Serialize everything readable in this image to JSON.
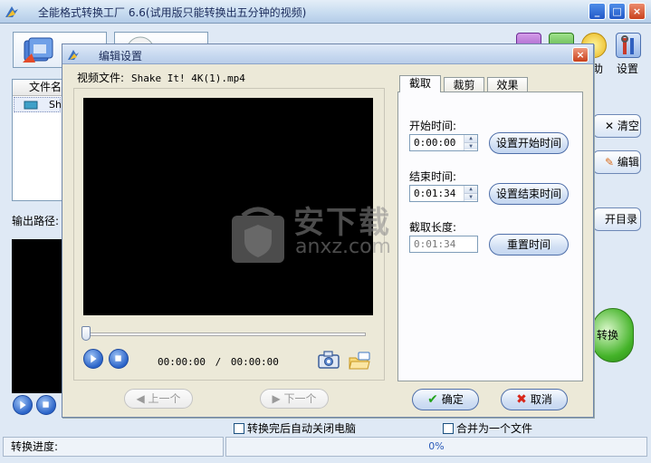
{
  "main_window": {
    "title": "全能格式转换工厂 6.6(试用版只能转换出五分钟的视频)",
    "window_buttons": [
      "_",
      "□",
      "×"
    ],
    "right_tools": [
      {
        "label": "",
        "icon": "purple-app-icon",
        "color": "#a05cc8"
      },
      {
        "label": "",
        "icon": "green-app-icon",
        "color": "#4fa83a"
      },
      {
        "label": "助",
        "icon": "help-icon",
        "color": "#f0c020"
      },
      {
        "label": "设置",
        "icon": "settings-tools-icon",
        "color": "#3a6fd0"
      }
    ],
    "file_list_header": "文件名",
    "file_list_row": "Sh",
    "side_buttons": {
      "clear": "清空",
      "edit": "编辑",
      "open_dir": "开目录"
    },
    "output_path_label": "输出路径:",
    "convert_label": "转换",
    "checkbox_auto_shutdown": "转换完后自动关闭电脑",
    "checkbox_merge": "合并为一个文件",
    "status_label": "转换进度:",
    "progress_text": "0%"
  },
  "dialog": {
    "title": "编辑设置",
    "close_glyph": "×",
    "video_file_label": "视频文件:",
    "video_file_name": "Shake It! 4K(1).mp4",
    "time_current": "00:00:00",
    "time_separator": "/",
    "time_total": "00:00:00",
    "seek_position_fraction": 0.0,
    "prev_label": "上一个",
    "next_label": "下一个",
    "tabs": [
      "截取",
      "裁剪",
      "效果"
    ],
    "active_tab": "截取",
    "start_time_label": "开始时间:",
    "start_time_value": "0:00:00",
    "set_start_button": "设置开始时间",
    "end_time_label": "结束时间:",
    "end_time_value": "0:01:34",
    "set_end_button": "设置结束时间",
    "duration_label": "截取长度:",
    "duration_value": "0:01:34",
    "reset_button": "重置时间",
    "ok_label": "确定",
    "cancel_label": "取消"
  },
  "watermark": {
    "cn": "安下载",
    "en": "anxz.com"
  }
}
